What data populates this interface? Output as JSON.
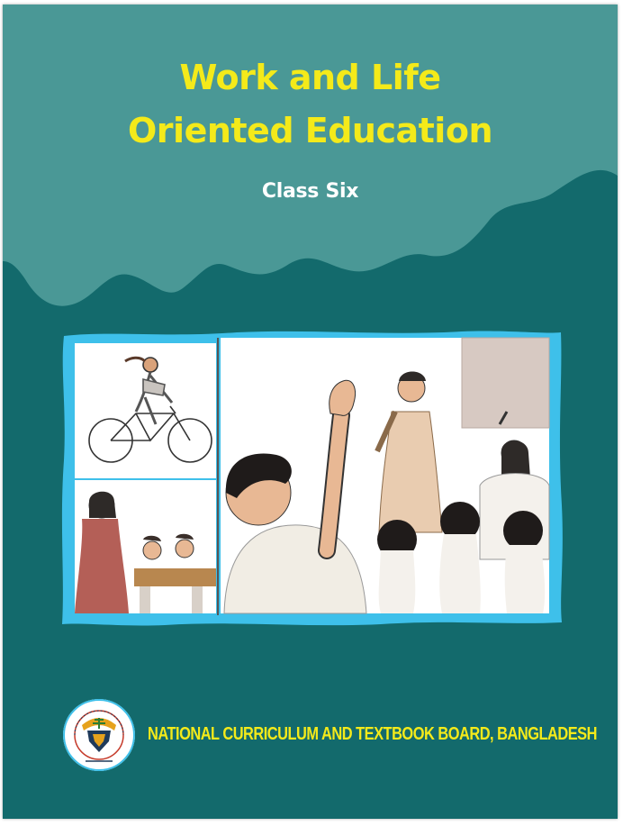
{
  "book": {
    "title_line1": "Work and Life",
    "title_line2": "Oriented Education",
    "class_label": "Class Six",
    "publisher": "NATIONAL CURRICULUM AND TEXTBOOK BOARD, BANGLADESH"
  },
  "illustration": {
    "panels": [
      "girl-riding-bicycle-panel",
      "teacher-with-students-panel",
      "classroom-raised-hands-panel"
    ]
  },
  "colors": {
    "background": "#136a6c",
    "wave": "#4f9a98",
    "title": "#f4ea1a",
    "subtitle": "#ffffff",
    "frame": "#3ec0ea"
  }
}
